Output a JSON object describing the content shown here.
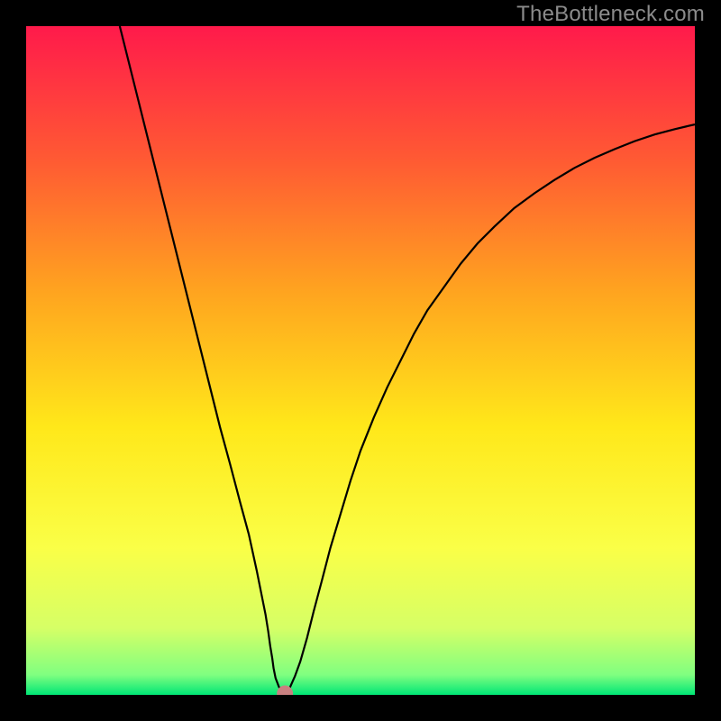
{
  "watermark": "TheBottleneck.com",
  "chart_data": {
    "type": "line",
    "title": "",
    "xlabel": "",
    "ylabel": "",
    "xlim": [
      0,
      100
    ],
    "ylim": [
      0,
      100
    ],
    "grid": false,
    "legend": false,
    "background_gradient": {
      "stops": [
        {
          "offset": 0.0,
          "color": "#ff1a4b"
        },
        {
          "offset": 0.2,
          "color": "#ff5a33"
        },
        {
          "offset": 0.4,
          "color": "#ffa51f"
        },
        {
          "offset": 0.6,
          "color": "#ffe81a"
        },
        {
          "offset": 0.78,
          "color": "#faff47"
        },
        {
          "offset": 0.9,
          "color": "#d6ff66"
        },
        {
          "offset": 0.97,
          "color": "#80ff80"
        },
        {
          "offset": 1.0,
          "color": "#00e676"
        }
      ]
    },
    "series": [
      {
        "name": "curve",
        "color": "#000000",
        "x": [
          14.0,
          15.5,
          17.0,
          18.5,
          20.0,
          21.5,
          23.0,
          24.5,
          26.0,
          27.5,
          29.0,
          30.5,
          32.0,
          33.3,
          34.5,
          35.2,
          35.8,
          36.2,
          36.5,
          36.8,
          37.0,
          37.3,
          37.8,
          38.3,
          38.7,
          38.9,
          39.4,
          40.2,
          41.0,
          42.0,
          43.0,
          44.2,
          45.5,
          47.0,
          48.5,
          50.0,
          52.0,
          54.0,
          56.0,
          58.0,
          60.0,
          62.5,
          65.0,
          67.5,
          70.0,
          73.0,
          76.0,
          79.0,
          82.0,
          85.0,
          88.0,
          91.0,
          94.0,
          97.0,
          100.0
        ],
        "y": [
          100.0,
          94.0,
          88.0,
          82.0,
          76.0,
          70.0,
          64.0,
          58.0,
          52.0,
          46.0,
          40.0,
          34.5,
          28.8,
          24.0,
          18.5,
          15.0,
          12.0,
          9.5,
          7.3,
          5.5,
          4.0,
          2.5,
          1.2,
          0.5,
          0.2,
          0.2,
          1.0,
          2.8,
          5.0,
          8.5,
          12.5,
          17.0,
          22.0,
          27.0,
          32.0,
          36.5,
          41.5,
          46.0,
          50.0,
          54.0,
          57.5,
          61.0,
          64.5,
          67.5,
          70.0,
          72.8,
          75.0,
          77.0,
          78.8,
          80.3,
          81.6,
          82.8,
          83.8,
          84.6,
          85.3
        ]
      }
    ],
    "marker": {
      "x": 38.7,
      "y": 0.2,
      "color": "#c98080",
      "radius": 9
    }
  }
}
